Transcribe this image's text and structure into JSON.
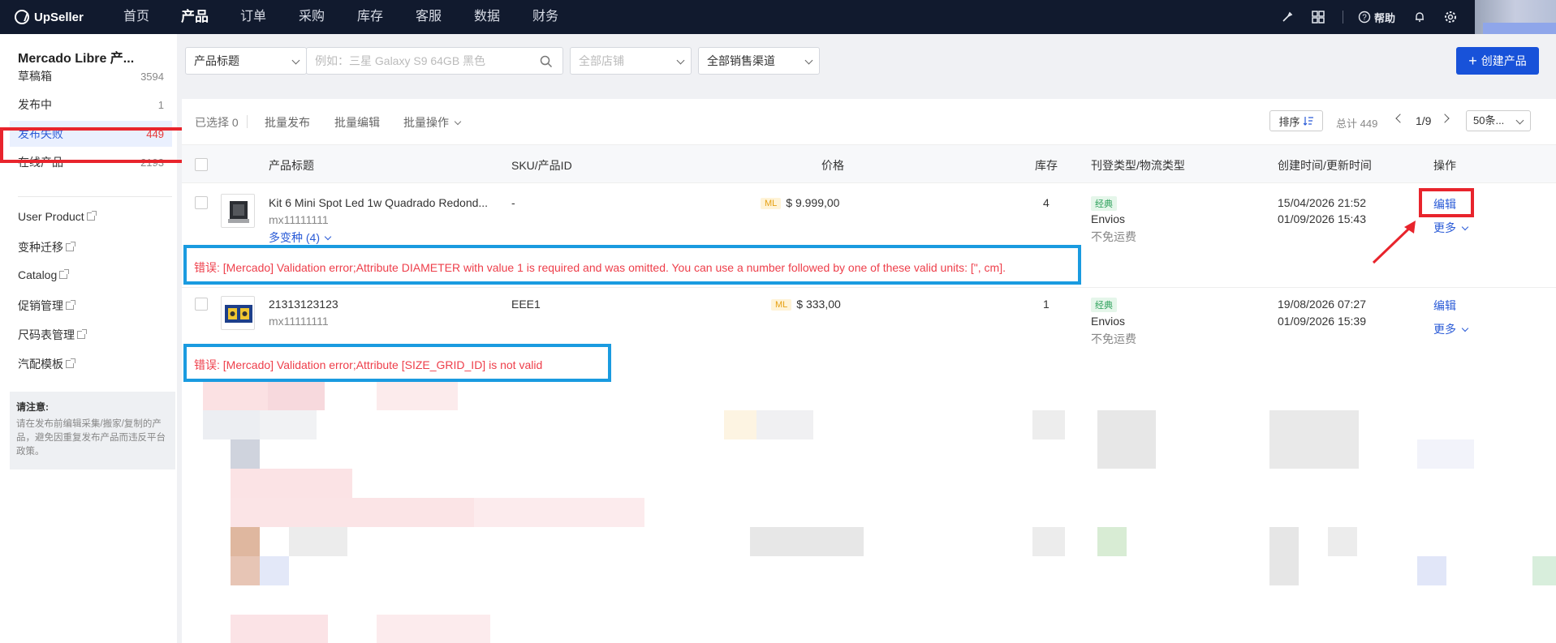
{
  "app": {
    "name": "UpSeller"
  },
  "nav": [
    "首页",
    "产品",
    "订单",
    "采购",
    "库存",
    "客服",
    "数据",
    "财务"
  ],
  "nav_active": "产品",
  "top_right": {
    "help": "帮助"
  },
  "sidebar": {
    "title": "Mercado Libre 产...",
    "items": [
      {
        "label": "草稿箱",
        "count": "3594"
      },
      {
        "label": "发布中",
        "count": "1"
      },
      {
        "label": "发布失败",
        "count": "449"
      },
      {
        "label": "在线产品",
        "count": "2193"
      }
    ],
    "links": [
      "User Product",
      "变种迁移",
      "Catalog",
      "促销管理",
      "尺码表管理",
      "汽配模板"
    ],
    "notice_title": "请注意:",
    "notice_body": "请在发布前编辑采集/搬家/复制的产品，避免因重复发布产品而违反平台政策。"
  },
  "filters": {
    "field": "产品标题",
    "search_placeholder": "例如：三星 Galaxy S9 64GB 黑色",
    "store": "全部店铺",
    "channel": "全部销售渠道",
    "create": "创建产品"
  },
  "toolbar": {
    "selected": "已选择 0",
    "batch_publish": "批量发布",
    "batch_edit": "批量编辑",
    "batch_ops": "批量操作",
    "sort": "排序",
    "total": "总计 449",
    "page": "1/9",
    "page_size": "50条..."
  },
  "columns": [
    "产品标题",
    "SKU/产品ID",
    "价格",
    "库存",
    "刊登类型/物流类型",
    "创建时间/更新时间",
    "操作"
  ],
  "rows": [
    {
      "title": "Kit 6 Mini Spot Led 1w Quadrado Redond...",
      "id": "mx11111111",
      "variants": "多变种 (4)",
      "sku": "-",
      "badge": "ML",
      "price": "$ 9.999,00",
      "stock": "4",
      "listing_type": "经典",
      "shipping": "Envios",
      "freight": "不免运费",
      "created": "15/04/2026 21:52",
      "updated": "01/09/2026 15:43",
      "edit": "编辑",
      "more": "更多",
      "error": "错误: [Mercado] Validation error;Attribute DIAMETER with value 1 is required and was omitted. You can use a number followed by one of these valid units: [\", cm]."
    },
    {
      "title": "21313123123",
      "id": "mx11111111",
      "sku": "EEE1",
      "badge": "ML",
      "price": "$ 333,00",
      "stock": "1",
      "listing_type": "经典",
      "shipping": "Envios",
      "freight": "不免运费",
      "created": "19/08/2026 07:27",
      "updated": "01/09/2026 15:39",
      "edit": "编辑",
      "more": "更多",
      "error": "错误: [Mercado] Validation error;Attribute [SIZE_GRID_ID] is not valid"
    }
  ]
}
